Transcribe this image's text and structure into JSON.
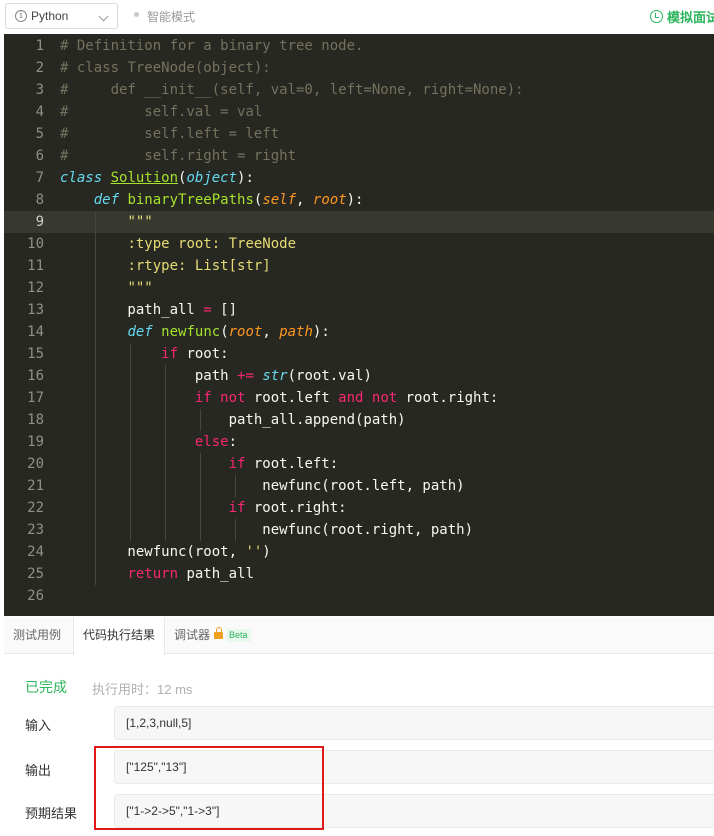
{
  "toolbar": {
    "language": "Python",
    "smart_mode": "智能模式",
    "mock_interview": "模拟面试"
  },
  "editor": {
    "active_line": 9,
    "lines": [
      [
        [
          "c-cm",
          "# Definition for a binary tree node."
        ]
      ],
      [
        [
          "c-cm",
          "# class TreeNode(object):"
        ]
      ],
      [
        [
          "c-cm",
          "#     def __init__(self, val=0, left=None, right=None):"
        ]
      ],
      [
        [
          "c-cm",
          "#         self.val = val"
        ]
      ],
      [
        [
          "c-cm",
          "#         self.left = left"
        ]
      ],
      [
        [
          "c-cm",
          "#         self.right = right"
        ]
      ],
      [
        [
          "c-def",
          "class"
        ],
        [
          "c-tx",
          " "
        ],
        [
          "c-cls",
          "Solution"
        ],
        [
          "c-tx",
          "("
        ],
        [
          "c-bi",
          "object"
        ],
        [
          "c-tx",
          "):"
        ]
      ],
      [
        [
          "c-tx",
          "    "
        ],
        [
          "c-def",
          "def"
        ],
        [
          "c-tx",
          " "
        ],
        [
          "c-fn",
          "binaryTreePaths"
        ],
        [
          "c-tx",
          "("
        ],
        [
          "c-arg",
          "self"
        ],
        [
          "c-tx",
          ", "
        ],
        [
          "c-arg",
          "root"
        ],
        [
          "c-tx",
          "):"
        ]
      ],
      [
        [
          "c-tx",
          "        "
        ],
        [
          "c-str",
          "\"\"\""
        ]
      ],
      [
        [
          "c-tx",
          "        "
        ],
        [
          "c-str",
          ":type root: TreeNode"
        ]
      ],
      [
        [
          "c-tx",
          "        "
        ],
        [
          "c-str",
          ":rtype: List[str]"
        ]
      ],
      [
        [
          "c-tx",
          "        "
        ],
        [
          "c-str",
          "\"\"\""
        ]
      ],
      [
        [
          "c-tx",
          "        path_all "
        ],
        [
          "c-kw",
          "="
        ],
        [
          "c-tx",
          " []"
        ]
      ],
      [
        [
          "c-tx",
          "        "
        ],
        [
          "c-def",
          "def"
        ],
        [
          "c-tx",
          " "
        ],
        [
          "c-fn",
          "newfunc"
        ],
        [
          "c-tx",
          "("
        ],
        [
          "c-arg",
          "root"
        ],
        [
          "c-tx",
          ", "
        ],
        [
          "c-arg",
          "path"
        ],
        [
          "c-tx",
          "):"
        ]
      ],
      [
        [
          "c-tx",
          "            "
        ],
        [
          "c-kw",
          "if"
        ],
        [
          "c-tx",
          " root:"
        ]
      ],
      [
        [
          "c-tx",
          "                path "
        ],
        [
          "c-kw",
          "+="
        ],
        [
          "c-tx",
          " "
        ],
        [
          "c-bi",
          "str"
        ],
        [
          "c-tx",
          "(root.val)"
        ]
      ],
      [
        [
          "c-tx",
          "                "
        ],
        [
          "c-kw",
          "if"
        ],
        [
          "c-tx",
          " "
        ],
        [
          "c-kw",
          "not"
        ],
        [
          "c-tx",
          " root.left "
        ],
        [
          "c-kw",
          "and"
        ],
        [
          "c-tx",
          " "
        ],
        [
          "c-kw",
          "not"
        ],
        [
          "c-tx",
          " root.right:"
        ]
      ],
      [
        [
          "c-tx",
          "                    path_all.append(path)"
        ]
      ],
      [
        [
          "c-tx",
          "                "
        ],
        [
          "c-kw",
          "else"
        ],
        [
          "c-tx",
          ":"
        ]
      ],
      [
        [
          "c-tx",
          "                    "
        ],
        [
          "c-kw",
          "if"
        ],
        [
          "c-tx",
          " root.left:"
        ]
      ],
      [
        [
          "c-tx",
          "                        newfunc(root.left, path)"
        ]
      ],
      [
        [
          "c-tx",
          "                    "
        ],
        [
          "c-kw",
          "if"
        ],
        [
          "c-tx",
          " root.right:"
        ]
      ],
      [
        [
          "c-tx",
          "                        newfunc(root.right, path)"
        ]
      ],
      [
        [
          "c-tx",
          "        newfunc(root, "
        ],
        [
          "c-str",
          "''"
        ],
        [
          "c-tx",
          ")"
        ]
      ],
      [
        [
          "c-tx",
          "        "
        ],
        [
          "c-kw",
          "return"
        ],
        [
          "c-tx",
          " path_all"
        ]
      ],
      []
    ]
  },
  "tabs": {
    "testcase": "测试用例",
    "result": "代码执行结果",
    "debugger": "调试器",
    "beta": "Beta"
  },
  "result": {
    "status": "已完成",
    "exec_time": "执行用时：12 ms",
    "input_label": "输入",
    "input_value": "[1,2,3,null,5]",
    "output_label": "输出",
    "output_value": "[\"125\",\"13\"]",
    "expected_label": "预期结果",
    "expected_value": "[\"1->2->5\",\"1->3\"]"
  }
}
